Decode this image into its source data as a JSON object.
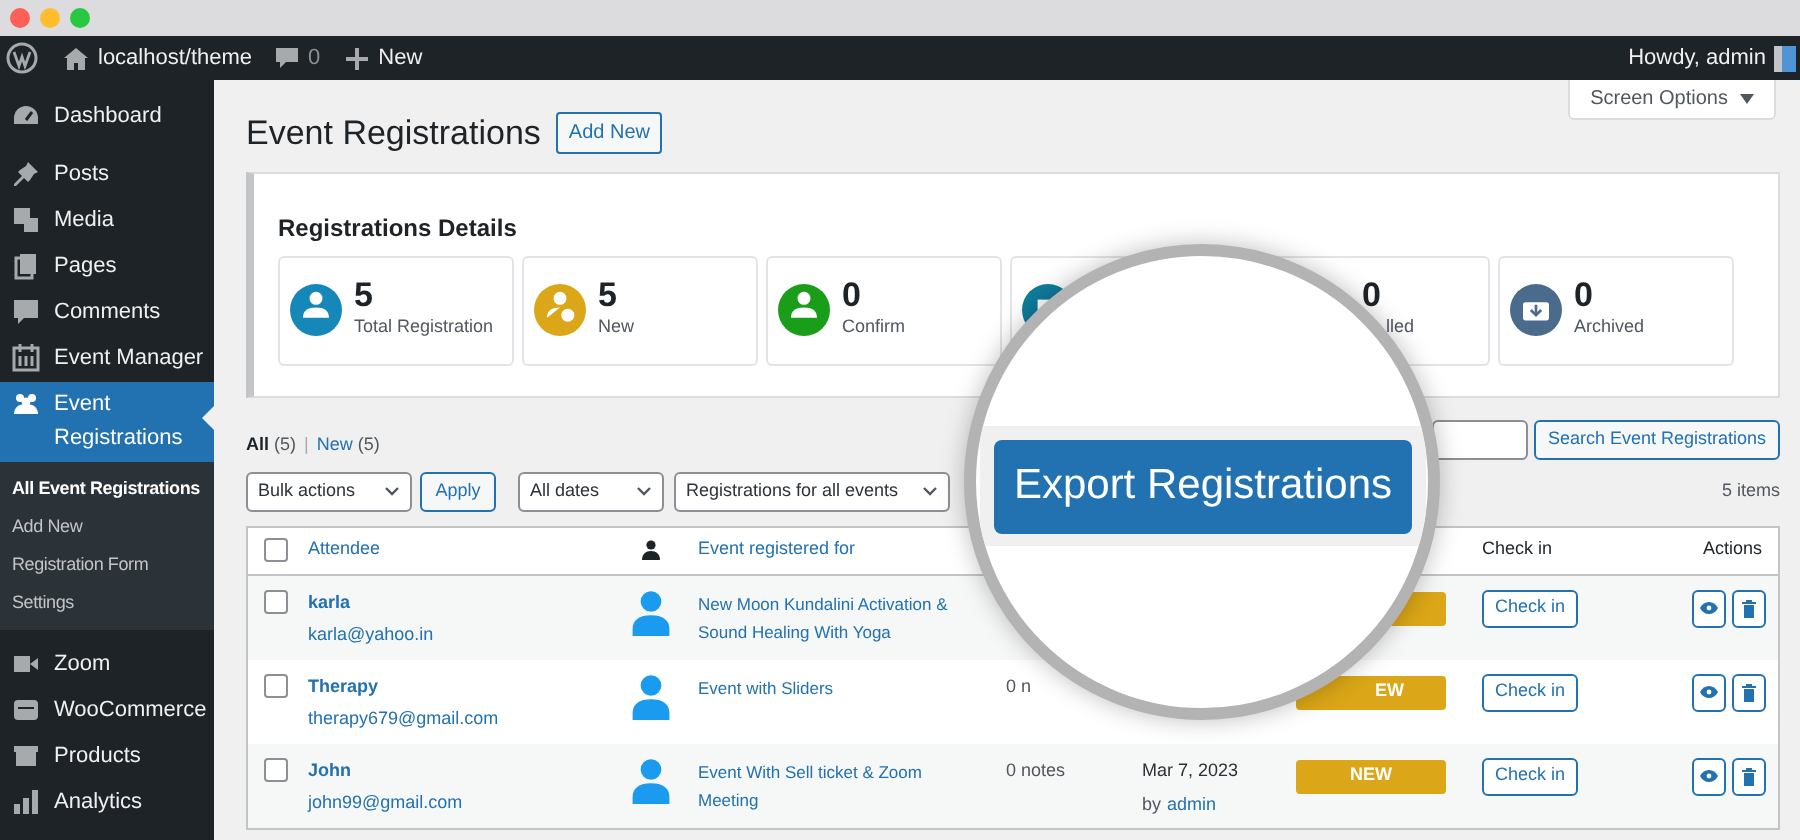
{
  "admin_bar": {
    "site": "localhost/theme",
    "comments": "0",
    "new": "New",
    "greeting": "Howdy, admin"
  },
  "sidebar": {
    "items": [
      {
        "label": "Dashboard",
        "selected": false
      },
      {
        "label": "Posts",
        "selected": false
      },
      {
        "label": "Media",
        "selected": false
      },
      {
        "label": "Pages",
        "selected": false
      },
      {
        "label": "Comments",
        "selected": false
      },
      {
        "label": "Event Manager",
        "selected": false
      },
      {
        "label": "Event Registrations",
        "selected": true,
        "children": [
          {
            "label": "All Event Registrations",
            "selected": true
          },
          {
            "label": "Add New",
            "selected": false
          },
          {
            "label": "Registration Form",
            "selected": false
          },
          {
            "label": "Settings",
            "selected": false
          }
        ]
      },
      {
        "label": "Zoom",
        "selected": false
      },
      {
        "label": "WooCommerce",
        "selected": false
      },
      {
        "label": "Products",
        "selected": false
      },
      {
        "label": "Analytics",
        "selected": false
      }
    ]
  },
  "page": {
    "title": "Event Registrations",
    "add_new": "Add New",
    "screen_options": "Screen Options"
  },
  "details": {
    "heading": "Registrations Details",
    "cards": [
      {
        "count": "5",
        "label": "Total Registration",
        "color": "#1587b8"
      },
      {
        "count": "5",
        "label": "New",
        "color": "#dba617"
      },
      {
        "count": "0",
        "label": "Confirm",
        "color": "#1a9e1a"
      },
      {
        "color": "#0f7c9c"
      },
      {
        "count": "0",
        "label": "lled"
      },
      {
        "count": "0",
        "label": "Archived",
        "color": "#4b6b8c"
      }
    ]
  },
  "views": [
    {
      "label": "All",
      "count": "(5)",
      "selected": true
    },
    {
      "label": "New",
      "count": "(5)",
      "selected": false
    }
  ],
  "views_separator": "|",
  "filters": {
    "bulk": "Bulk actions",
    "apply": "Apply",
    "dates": "All dates",
    "events": "Registrations for all events",
    "search_button": "Search Event Registrations",
    "items": "5 items"
  },
  "export_button": "Export Registrations",
  "table": {
    "select_all": {
      "checked": false
    },
    "columns": {
      "attendee": "Attendee",
      "event": "Event registered for",
      "check_in": "Check in",
      "actions": "Actions"
    },
    "rows": [
      {
        "name": "karla",
        "email": "karla@yahoo.in",
        "event": "New Moon Kundalini Activation & Sound Healing With Yoga",
        "check_in": "Check in",
        "checked": false
      },
      {
        "name": "Therapy",
        "email": "therapy679@gmail.com",
        "event": "Event with Sliders",
        "notes": "0 n",
        "status": "EW",
        "check_in": "Check in",
        "checked": false
      },
      {
        "name": "John",
        "email": "john99@gmail.com",
        "event": "Event With Sell ticket & Zoom Meeting",
        "notes": "0 notes",
        "date": "Mar 7, 2023",
        "by": "by",
        "author": "admin",
        "status": "NEW",
        "check_in": "Check in",
        "checked": false
      }
    ]
  }
}
